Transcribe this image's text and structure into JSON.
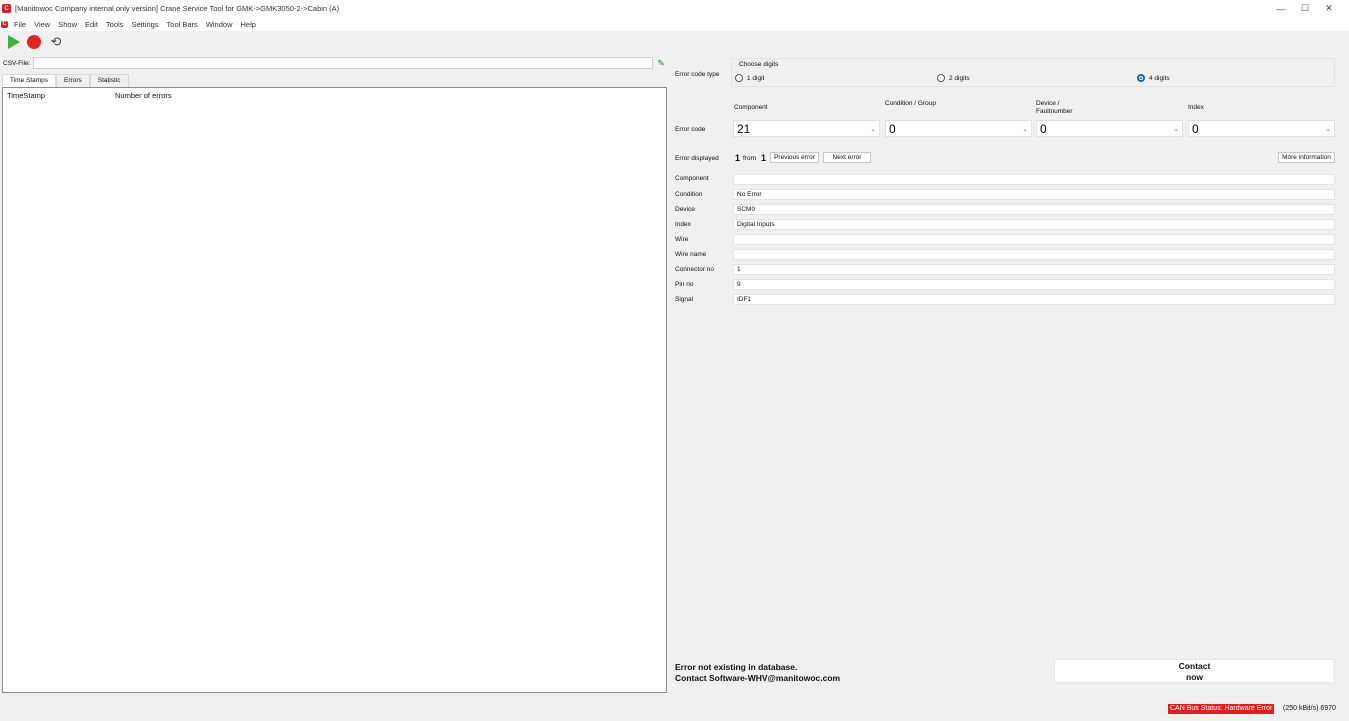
{
  "window": {
    "title": "[Manitowoc Company internal only  version] Crane Service Tool for GMK->GMK3050-2->Cabin (A)",
    "app_icon_text": "C",
    "controls": [
      "—",
      "☐",
      "✕"
    ]
  },
  "menu": [
    "File",
    "View",
    "Show",
    "Edit",
    "Tools",
    "Settings",
    "Tool Bars",
    "Window",
    "Help"
  ],
  "csv": {
    "label": "CSV-File:",
    "value": ""
  },
  "tabs": [
    "Time Stamps",
    "Errors",
    "Statistic"
  ],
  "list": {
    "headers": [
      "TimeStamp",
      "Number of errors"
    ]
  },
  "error_code_type": {
    "label": "Error code type",
    "group_title": "Choose digits",
    "options": [
      "1 digit",
      "2 digits",
      "4 digits"
    ],
    "selected": "4 digits"
  },
  "error_code": {
    "label": "Error code",
    "columns": [
      {
        "header": "Component",
        "value": "21"
      },
      {
        "header": "Condition / Group",
        "value": "0"
      },
      {
        "header": "Device / Faultnumber",
        "value": "0"
      },
      {
        "header": "Index",
        "value": "0"
      }
    ]
  },
  "error_displayed": {
    "label": "Error displayed",
    "current": "1",
    "from_label": "from",
    "total": "1",
    "previous_label": "Previous error",
    "next_label": "Next error",
    "more_label": "More information"
  },
  "details": [
    {
      "label": "Component",
      "value": ""
    },
    {
      "label": "Condition",
      "value": "No Error"
    },
    {
      "label": "Device",
      "value": "SCM0"
    },
    {
      "label": "Index",
      "value": "Digital Inputs"
    },
    {
      "label": "Wire",
      "value": ""
    },
    {
      "label": "Wire name",
      "value": ""
    },
    {
      "label": "Connector no",
      "value": "1"
    },
    {
      "label": "Pin no",
      "value": "9"
    },
    {
      "label": "Signal",
      "value": "IDF1"
    }
  ],
  "message": {
    "line1": "Error not existing in database.",
    "line2": "Contact Software-WHV@manitowoc.com"
  },
  "contact_button": {
    "line1": "Contact",
    "line2": "now"
  },
  "status": {
    "can_status": "CAN Bus Status: Hardware Error",
    "rate": "(250 kBit/s)  6970",
    "can_color": "#e02020"
  }
}
